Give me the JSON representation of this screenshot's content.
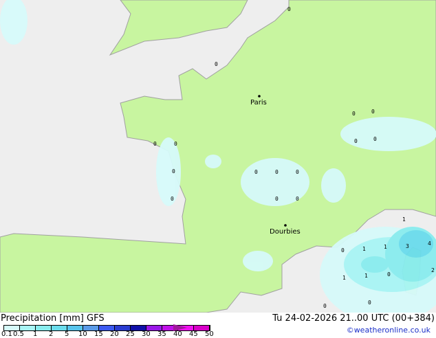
{
  "map": {
    "colors": {
      "sea": "#eeeeee",
      "land": "#c8f5a0",
      "border": "#a0a0a0"
    },
    "cities": [
      {
        "name": "Paris"
      },
      {
        "name": "Dourbies"
      }
    ],
    "values": [
      "0",
      "0",
      "0",
      "0",
      "0",
      "0",
      "0",
      "0",
      "0",
      "0",
      "0",
      "0",
      "0",
      "0",
      "0",
      "1",
      "0",
      "1",
      "3",
      "4",
      "1",
      "2",
      "1",
      "1",
      "0",
      "0",
      "0"
    ]
  },
  "footer": {
    "title": "Precipitation [mm]  GFS",
    "datetime": "Tu 24-02-2026 21..00 UTC (00+384)",
    "copyright": "©weatheronline.co.uk",
    "legend_ticks": [
      "0.1",
      "0.5",
      "1",
      "2",
      "5",
      "10",
      "15",
      "20",
      "25",
      "30",
      "35",
      "40",
      "45",
      "50"
    ],
    "legend_colors": [
      "#d6fafa",
      "#a8f5f5",
      "#88ecee",
      "#6adcec",
      "#58c4ec",
      "#5a9ae8",
      "#3c5af0",
      "#2a3cd0",
      "#1010a8",
      "#9a18e8",
      "#c010e8",
      "#f010f0",
      "#d800c8"
    ],
    "legend_arrow_color": "#a0189c"
  }
}
